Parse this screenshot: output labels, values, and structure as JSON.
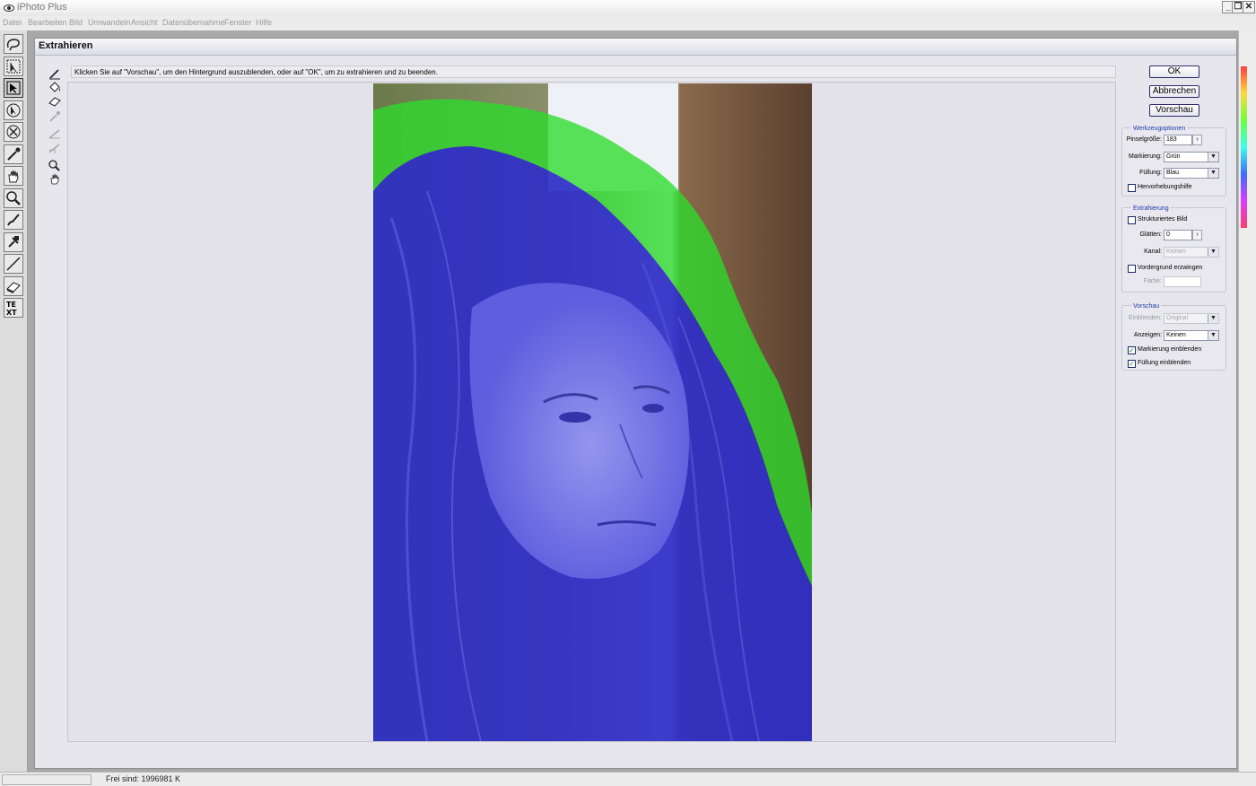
{
  "app": {
    "title": "iPhoto Plus"
  },
  "menu": [
    "Datei",
    "Bearbeiten",
    "Bild",
    "Umwandeln",
    "Ansicht",
    "Datenübernahme",
    "Fenster",
    "Hilfe"
  ],
  "dialog": {
    "title": "Extrahieren",
    "instruction": "Klicken Sie auf \"Vorschau\", um den Hintergrund auszublenden, oder auf \"OK\", um zu extrahieren und zu beenden.",
    "buttons": {
      "ok": "OK",
      "cancel": "Abbrechen",
      "preview": "Vorschau"
    },
    "tool_options": {
      "title": "Werkzeugoptionen",
      "brush_size_label": "Pinselgröße:",
      "brush_size_value": "183",
      "highlight_label": "Markierung:",
      "highlight_value": "Grün",
      "fill_label": "Füllung:",
      "fill_value": "Blau",
      "smart_highlight_label": "Hervorhebungshilfe",
      "smart_highlight_checked": false
    },
    "extraction": {
      "title": "Extrahierung",
      "textured_label": "Strukturiertes Bild",
      "textured_checked": false,
      "smooth_label": "Glätten:",
      "smooth_value": "0",
      "channel_label": "Kanal:",
      "channel_value": "Keinen",
      "force_fg_label": "Vordergrund erzwingen",
      "force_fg_checked": false,
      "color_label": "Farbe:"
    },
    "preview": {
      "title": "Vorschau",
      "show_label": "Einblenden:",
      "show_value": "Original",
      "display_label": "Anzeigen:",
      "display_value": "Keinen",
      "show_highlight_label": "Markierung einblenden",
      "show_highlight_checked": true,
      "show_fill_label": "Füllung einblenden",
      "show_fill_checked": true
    }
  },
  "status": {
    "free_memory": "Frei sind: 1996981 K"
  },
  "colors": {
    "highlight_green": "#3ae03a",
    "fill_blue": "#3a3ad8",
    "accent": "#1c3aa8"
  },
  "icons": {
    "left_toolbar": [
      "lasso-icon",
      "arrow-select-icon",
      "selection-icon",
      "pointer-icon",
      "retouch-icon",
      "eyedropper-icon",
      "hand-icon",
      "zoom-icon",
      "brush-icon",
      "clone-icon",
      "line-icon",
      "eraser-icon",
      "text-icon"
    ],
    "dialog_tools": [
      "edge-highlighter-icon",
      "fill-icon",
      "eraser-icon",
      "eyedropper-icon",
      "cleanup-icon",
      "edge-touchup-icon",
      "zoom-icon",
      "hand-icon"
    ]
  }
}
